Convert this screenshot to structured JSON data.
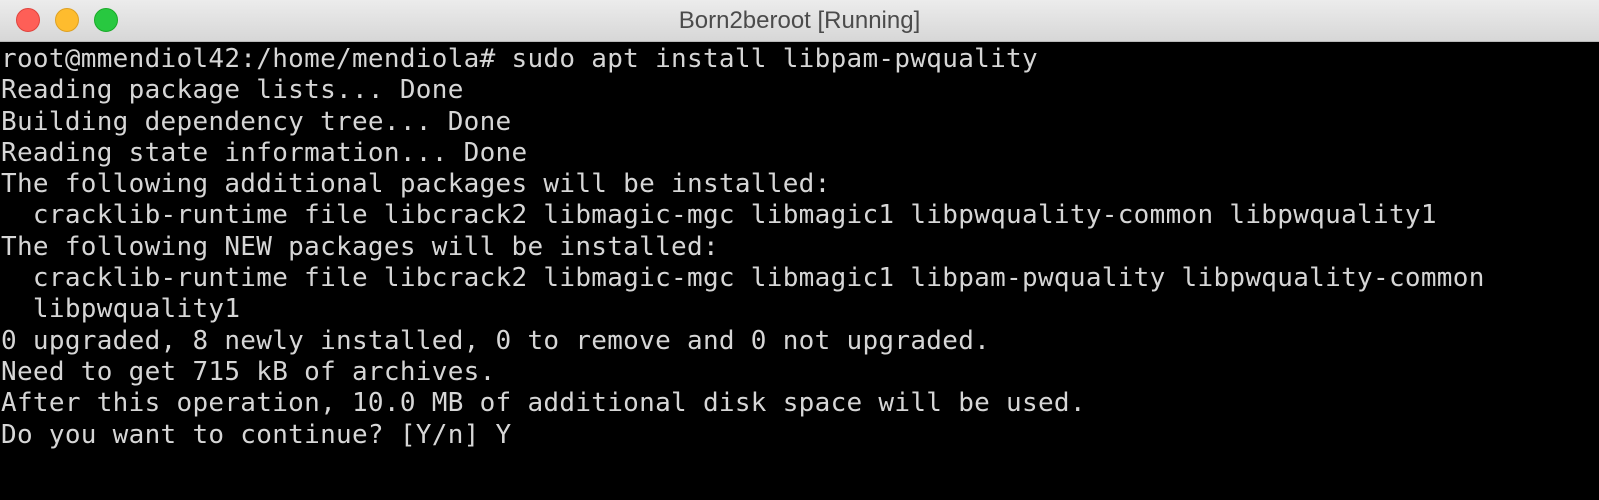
{
  "window": {
    "title": "Born2beroot [Running]"
  },
  "terminal": {
    "lines": [
      "root@mmendiol42:/home/mendiola# sudo apt install libpam-pwquality",
      "Reading package lists... Done",
      "Building dependency tree... Done",
      "Reading state information... Done",
      "The following additional packages will be installed:",
      "  cracklib-runtime file libcrack2 libmagic-mgc libmagic1 libpwquality-common libpwquality1",
      "The following NEW packages will be installed:",
      "  cracklib-runtime file libcrack2 libmagic-mgc libmagic1 libpam-pwquality libpwquality-common",
      "  libpwquality1",
      "0 upgraded, 8 newly installed, 0 to remove and 0 not upgraded.",
      "Need to get 715 kB of archives.",
      "After this operation, 10.0 MB of additional disk space will be used.",
      "Do you want to continue? [Y/n] Y"
    ]
  }
}
